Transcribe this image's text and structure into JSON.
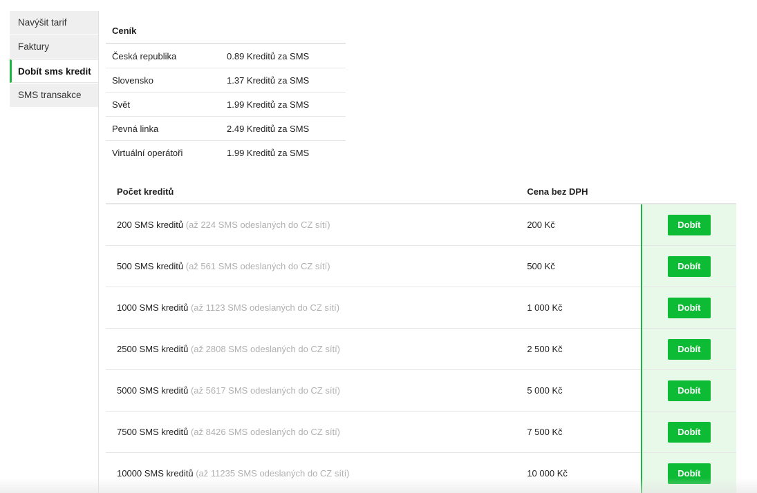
{
  "sidebar": {
    "items": [
      {
        "label": "Navýšit tarif"
      },
      {
        "label": "Faktury"
      },
      {
        "label": "Dobít sms kredit"
      },
      {
        "label": "SMS transakce"
      }
    ]
  },
  "pricelist": {
    "title": "Ceník",
    "rows": [
      {
        "region": "Česká republika",
        "price": "0.89 Kreditů za SMS"
      },
      {
        "region": "Slovensko",
        "price": "1.37 Kreditů za SMS"
      },
      {
        "region": "Svět",
        "price": "1.99 Kreditů za SMS"
      },
      {
        "region": "Pevná linka",
        "price": "2.49 Kreditů za SMS"
      },
      {
        "region": "Virtuální operátoři",
        "price": "1.99 Kreditů za SMS"
      }
    ]
  },
  "credits": {
    "header_count": "Počet kreditů",
    "header_price": "Cena bez DPH",
    "button_label": "Dobít",
    "rows": [
      {
        "credits": "200 SMS kreditů",
        "note": "(až 224 SMS odeslaných do CZ sítí)",
        "price": "200 Kč"
      },
      {
        "credits": "500 SMS kreditů",
        "note": "(až 561 SMS odeslaných do CZ sítí)",
        "price": "500 Kč"
      },
      {
        "credits": "1000 SMS kreditů",
        "note": "(až 1123 SMS odeslaných do CZ sítí)",
        "price": "1 000 Kč"
      },
      {
        "credits": "2500 SMS kreditů",
        "note": "(až 2808 SMS odeslaných do CZ sítí)",
        "price": "2 500 Kč"
      },
      {
        "credits": "5000 SMS kreditů",
        "note": "(až 5617 SMS odeslaných do CZ sítí)",
        "price": "5 000 Kč"
      },
      {
        "credits": "7500 SMS kreditů",
        "note": "(až 8426 SMS odeslaných do CZ sítí)",
        "price": "7 500 Kč"
      },
      {
        "credits": "10000 SMS kreditů",
        "note": "(až 11235 SMS odeslaných do CZ sítí)",
        "price": "10 000 Kč"
      }
    ]
  },
  "colors": {
    "accent": "#0dbb34",
    "active_border": "#1bb53f",
    "highlight_column": "#e9f9e9",
    "muted_text": "#b0b0b0"
  }
}
